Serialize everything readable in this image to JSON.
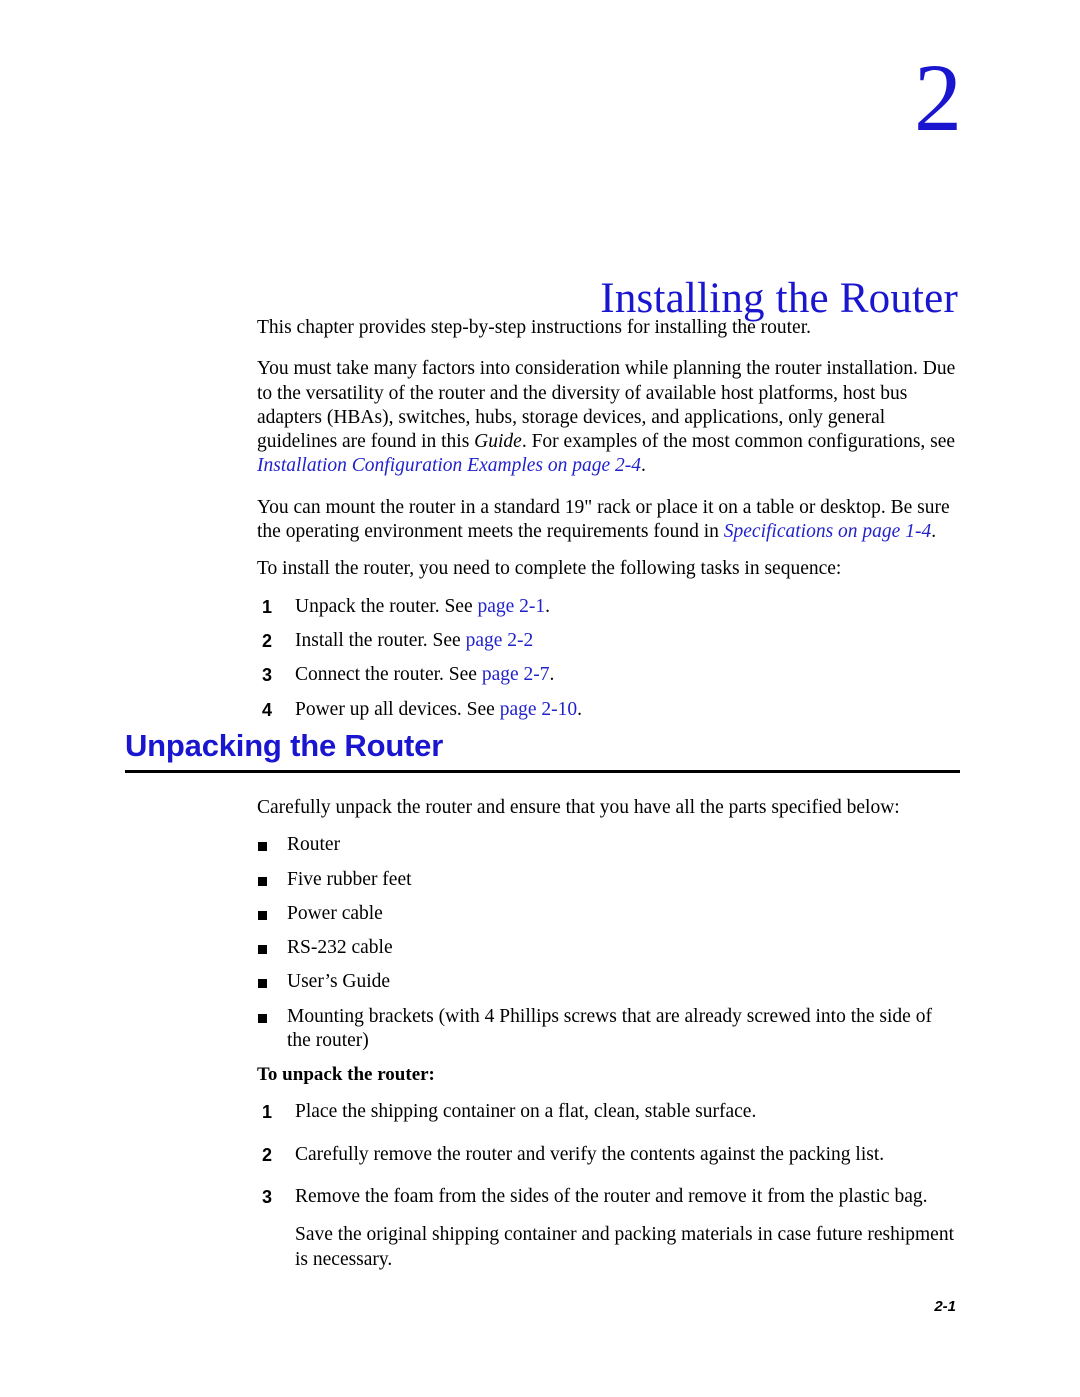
{
  "document": {
    "chapter_number": "2",
    "chapter_title": "Installing the Router",
    "footer_page_number": "2-1",
    "accent_color": "#1a16cf",
    "link_color": "#2222cc",
    "text_color": "#000000",
    "background_color": "#ffffff"
  },
  "intro": {
    "paragraph_1": "This chapter provides step-by-step instructions for installing the router.",
    "paragraph_2": {
      "part_1": "You must take many factors into consideration while planning the router installation. Due to the versatility of the router and the diversity of available host platforms, host bus adapters (HBAs), switches, hubs, storage devices, and applications, only general guidelines are found in this ",
      "italic_term": "Guide",
      "part_2": ". For examples of the most common configurations, see ",
      "xref": "Installation Configuration Examples on page 2-4",
      "part_3": "."
    },
    "paragraph_3": {
      "part_1": "You can mount the router in a standard 19\" rack or place it on a table or desktop. Be sure the operating environment meets the requirements found in ",
      "xref": "Specifications on page 1-4",
      "part_2": "."
    },
    "paragraph_4": "To install the router, you need to complete the following tasks in sequence:"
  },
  "task_list": {
    "items": [
      {
        "num": "1",
        "text_before": "Unpack the router. See ",
        "link": "page 2-1",
        "text_after": "."
      },
      {
        "num": "2",
        "text_before": "Install the router. See ",
        "link": "page 2-2",
        "text_after": ""
      },
      {
        "num": "3",
        "text_before": "Connect the router. See ",
        "link": "page 2-7",
        "text_after": "."
      },
      {
        "num": "4",
        "text_before": "Power up all devices. See ",
        "link": "page 2-10",
        "text_after": "."
      }
    ]
  },
  "section": {
    "heading": "Unpacking the Router",
    "intro": "Carefully unpack the router and ensure that you have all the parts specified below:",
    "parts": [
      {
        "label": "Router"
      },
      {
        "label": "Five rubber feet"
      },
      {
        "label": "Power cable"
      },
      {
        "label": "RS-232 cable"
      },
      {
        "label": "User’s Guide"
      },
      {
        "label": "Mounting brackets (with 4 Phillips screws that are already screwed into the side of the router)"
      }
    ],
    "procedure_heading": "To unpack the router:",
    "procedure_steps": [
      {
        "num": "1",
        "text": "Place the shipping container on a flat, clean, stable surface."
      },
      {
        "num": "2",
        "text": "Carefully remove the router and verify the contents against the packing list."
      },
      {
        "num": "3",
        "text": "Remove the foam from the sides of the router and remove it from the plastic bag."
      }
    ],
    "procedure_note": "Save the original shipping container and packing materials in case future reshipment is necessary."
  }
}
